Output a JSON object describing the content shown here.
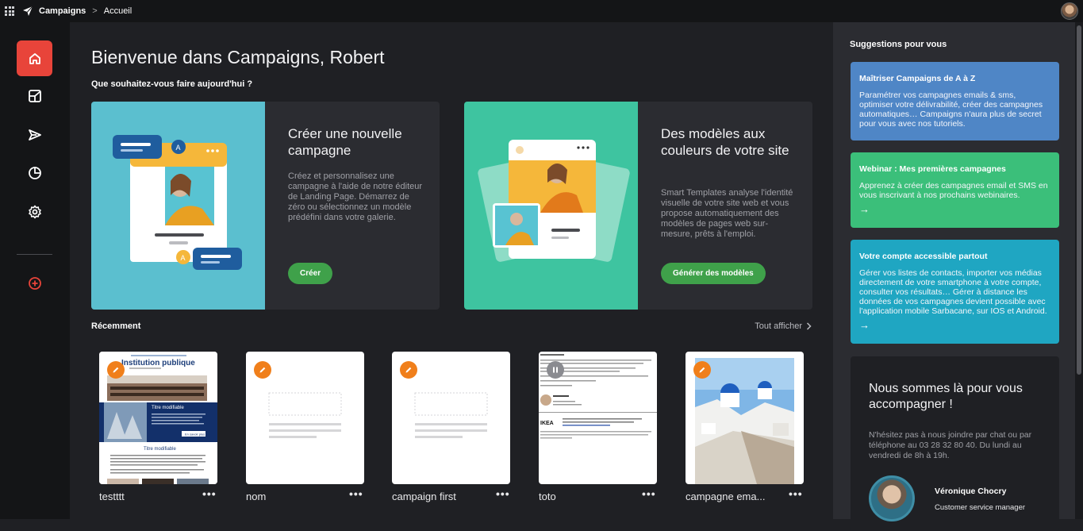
{
  "topbar": {
    "app_name": "Campaigns",
    "separator": ">",
    "breadcrumb": "Accueil"
  },
  "sidebar": {
    "items": [
      {
        "name": "home-icon",
        "active": true
      },
      {
        "name": "template-icon",
        "active": false
      },
      {
        "name": "send-icon",
        "active": false
      },
      {
        "name": "stats-icon",
        "active": false
      },
      {
        "name": "gear-icon",
        "active": false
      },
      {
        "name": "add-circle-icon",
        "active": false
      }
    ]
  },
  "main": {
    "welcome": "Bienvenue dans Campaigns, Robert",
    "question": "Que souhaitez-vous faire aujourd'hui ?",
    "cards": [
      {
        "title": "Créer une nouvelle campagne",
        "text": "Créez et personnalisez une campagne à l'aide de notre éditeur de Landing Page. Démarrez de zéro ou sélectionnez un modèle prédéfini dans votre galerie.",
        "button": "Créer"
      },
      {
        "title": "Des modèles aux couleurs de votre site",
        "text": "Smart Templates analyse l'identité visuelle de votre site web et vous propose automatiquement des modèles de pages web sur-mesure, prêts à l'emploi.",
        "button": "Générer des modèles"
      }
    ],
    "recent_title": "Récemment",
    "see_all": "Tout afficher",
    "recent": [
      {
        "label": "testttt",
        "more": "•••"
      },
      {
        "label": "nom",
        "more": "•••"
      },
      {
        "label": "campaign first",
        "more": "•••"
      },
      {
        "label": "toto",
        "more": "•••"
      },
      {
        "label": "campagne ema...",
        "more": "•••"
      }
    ],
    "thumb_text": {
      "institution": "Institution publique",
      "titre1": "Titre modifiable",
      "titre2": "Titre modifiable",
      "btn": "En savoir plus",
      "ikea": "IKEA"
    }
  },
  "right": {
    "heading": "Suggestions pour vous",
    "suggestions": [
      {
        "title": "Maîtriser Campaigns de A à Z",
        "text": "Paramétrer vos campagnes emails & sms, optimiser votre délivrabilité, créer des campagnes automatiques… Campaigns n'aura plus de secret pour vous avec nos tutoriels.",
        "color": "#4f86c6"
      },
      {
        "title": "Webinar : Mes premières campagnes",
        "text": "Apprenez à créer des campagnes email et SMS en vous inscrivant à nos prochains webinaires.",
        "arrow": "→",
        "color": "#3bbf7a"
      },
      {
        "title": "Votre compte accessible partout",
        "text": "Gérer vos listes de contacts, importer vos médias directement de votre smartphone à votre compte, consulter vos résultats… Gérer à distance les données de vos campagnes devient possible avec l'application mobile Sarbacane, sur IOS et Android.",
        "arrow": "→",
        "color": "#1fa6c2"
      }
    ],
    "support": {
      "title": "Nous sommes là pour vous accompagner !",
      "text": "N'hésitez pas à nous joindre par chat ou par téléphone au 03 28 32 80 40. Du lundi au vendredi de 8h à 19h.",
      "agent_name": "Véronique Chocry",
      "agent_role": "Customer service manager"
    }
  }
}
